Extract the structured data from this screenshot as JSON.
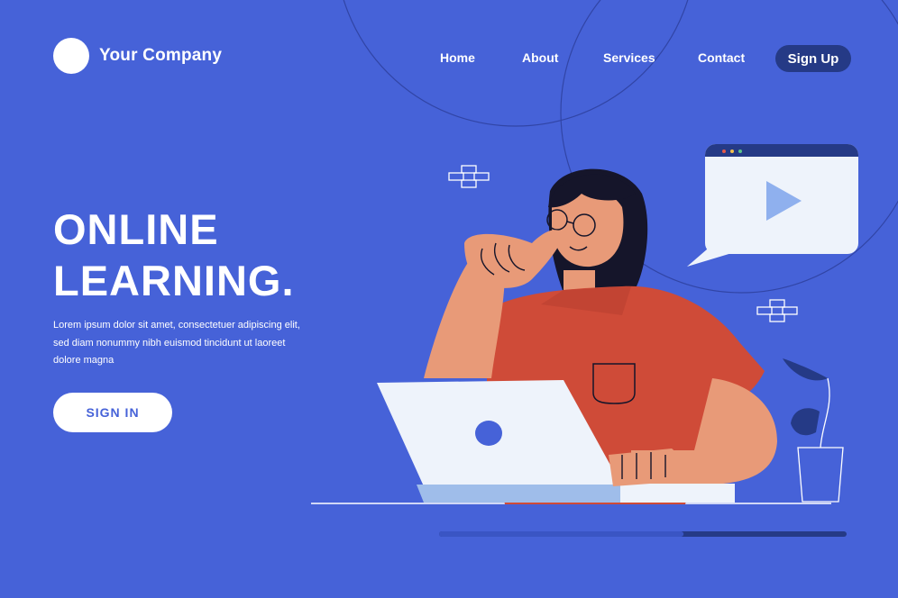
{
  "header": {
    "company_name": "Your Company",
    "nav": [
      {
        "label": "Home"
      },
      {
        "label": "About"
      },
      {
        "label": "Services"
      },
      {
        "label": "Contact"
      }
    ],
    "signup_label": "Sign Up"
  },
  "hero": {
    "title_line1": "ONLINE",
    "title_line2": "LEARNING.",
    "description_line1": "Lorem ipsum dolor sit amet, consectetuer adipiscing elit,",
    "description_line2": "sed diam nonummy nibh euismod tincidunt ut laoreet",
    "description_line3": "dolore magna",
    "signin_label": "SIGN IN"
  },
  "colors": {
    "background": "#4662d8",
    "button_dark": "#253a86",
    "shirt": "#cf4b38",
    "skin": "#e89a78",
    "laptop": "#eef3fb",
    "play_icon": "#8fb0ee"
  },
  "icons": [
    "logo-circle",
    "play-icon",
    "brick-icon",
    "plant-icon"
  ],
  "progress": {
    "value": 0.6
  }
}
